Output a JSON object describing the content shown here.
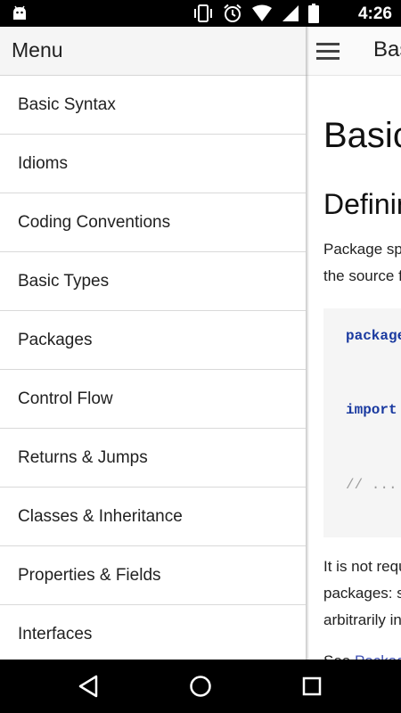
{
  "status_bar": {
    "time": "4:26",
    "icons": [
      "android-debug-icon",
      "vibrate-icon",
      "alarm-icon",
      "wifi-icon",
      "signal-icon",
      "battery-icon"
    ]
  },
  "content": {
    "topbar_title": "Basic Syntax",
    "heading": "Basic Syntax",
    "subheading": "Defining packages",
    "para1_line1": "Package specification should be at the top of",
    "para1_line2": "the source file:",
    "code_line1_kw": "package",
    "code_line2_kw": "import",
    "code_line3": "// ...",
    "para2_line1": "It is not required to match directories and",
    "para2_line2": "packages: source files can be placed",
    "para2_line3": "arbitrarily in the file system.",
    "para3_prefix": "See",
    "para3_link": "Packages"
  },
  "drawer": {
    "title": "Menu",
    "items": [
      {
        "label": "Basic Syntax"
      },
      {
        "label": "Idioms"
      },
      {
        "label": "Coding Conventions"
      },
      {
        "label": "Basic Types"
      },
      {
        "label": "Packages"
      },
      {
        "label": "Control Flow"
      },
      {
        "label": "Returns & Jumps"
      },
      {
        "label": "Classes & Inheritance"
      },
      {
        "label": "Properties & Fields"
      },
      {
        "label": "Interfaces"
      }
    ]
  },
  "colors": {
    "status_bar": "#000000",
    "keyword": "#1a3aa0",
    "link": "#3f51b5",
    "code_bg": "#f5f5f5"
  }
}
